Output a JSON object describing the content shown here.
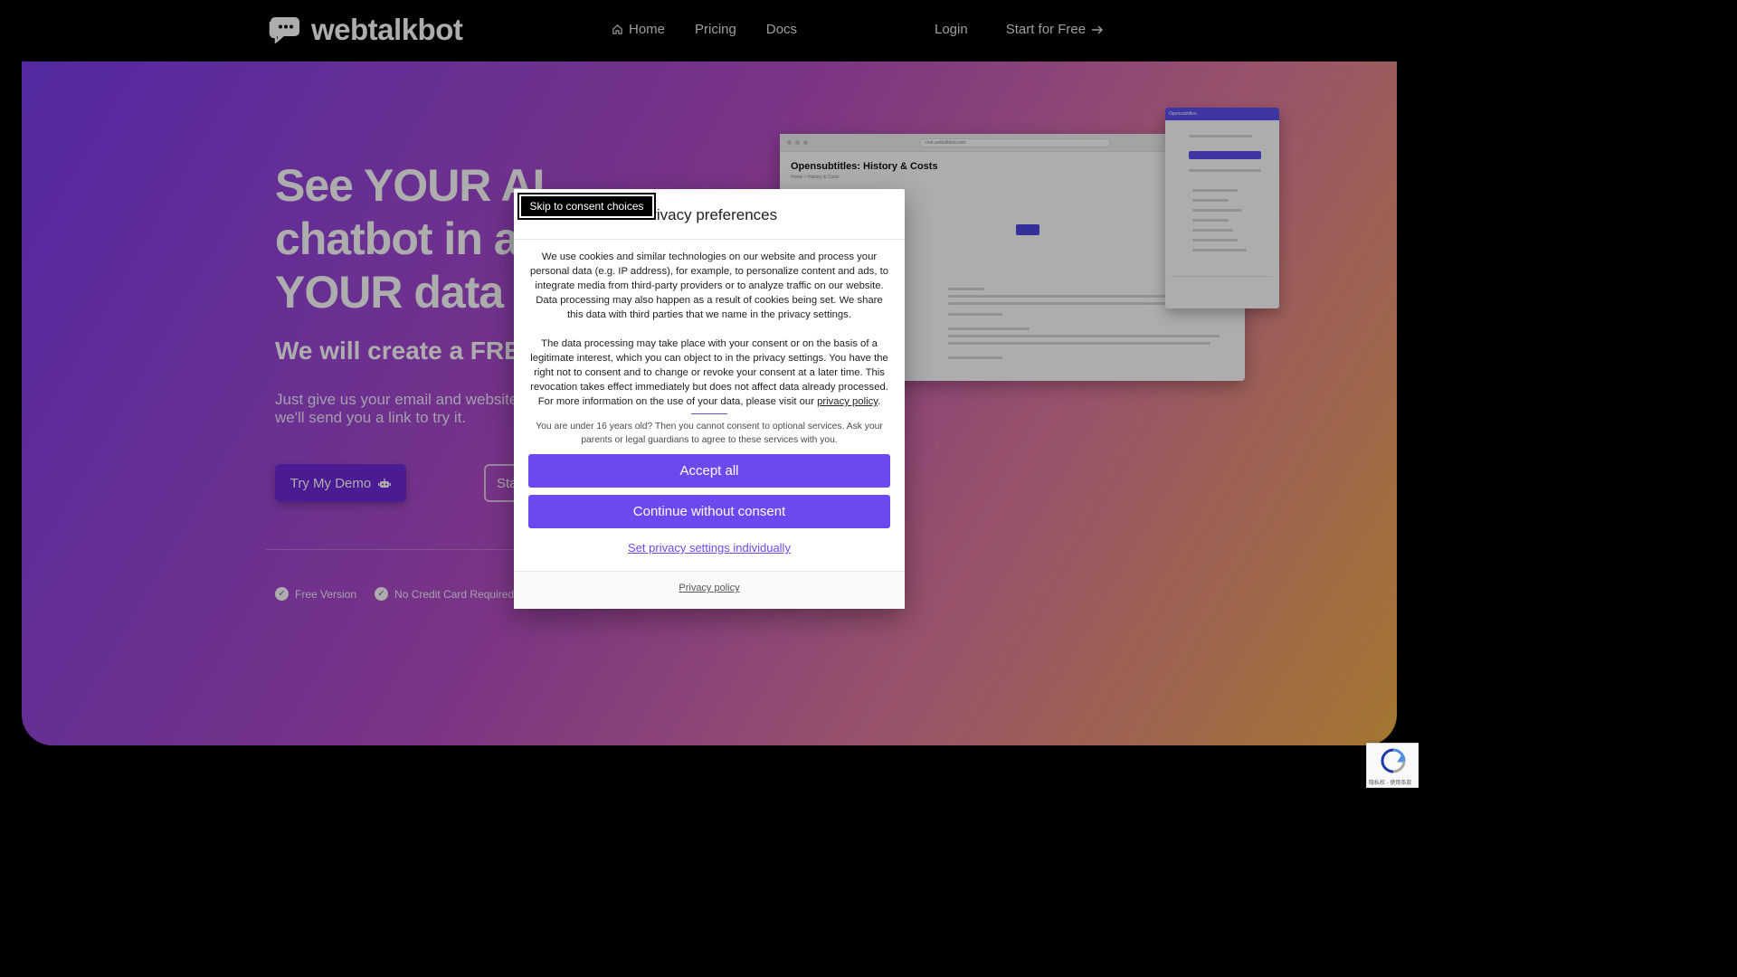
{
  "nav": {
    "brand": "webtalkbot",
    "home": "Home",
    "pricing": "Pricing",
    "docs": "Docs",
    "login": "Login",
    "start_free": "Start for Free"
  },
  "hero": {
    "title": "See YOUR AI chatbot in a YOUR data",
    "subtitle": "We will create a FREE",
    "description": "Just give us your email and website we'll send you a link to try it.",
    "demo_button": "Try My Demo",
    "start_button": "Sta",
    "features": [
      "Free Version",
      "No Credit Card Required"
    ],
    "preview_title": "Opensubtitles: History & Costs",
    "preview_breadcrumb": "Home  >  History & Costs",
    "preview_url": "chat.webtalkbot.com",
    "widget_title": "Opensubtitles"
  },
  "consent": {
    "skip_link": "Skip to consent choices",
    "title": "Privacy preferences",
    "paragraph1": "We use cookies and similar technologies on our website and process your personal data (e.g. IP address), for example, to personalize content and ads, to integrate media from third-party providers or to analyze traffic on our website. Data processing may also happen as a result of cookies being set. We share this data with third parties that we name in the privacy settings.",
    "paragraph2": "The data processing may take place with your consent or on the basis of a legitimate interest, which you can object to in the privacy settings. You have the right not to consent and to change or revoke your consent at a later time. This revocation takes effect immediately but does not affect data already processed. For more information on the use of your data, please visit our",
    "paragraph2_link": "privacy policy",
    "age_note": "You are under 16 years old? Then you cannot consent to optional services. Ask your parents or legal guardians to agree to these services with you.",
    "accept_all": "Accept all",
    "continue_without": "Continue without consent",
    "set_individually": "Set privacy settings individually",
    "footer_policy": "Privacy policy"
  },
  "recaptcha": {
    "text": "隐私权 - 使用条款"
  },
  "colors": {
    "accent": "#6c48ee",
    "nav_bg": "#000000"
  }
}
